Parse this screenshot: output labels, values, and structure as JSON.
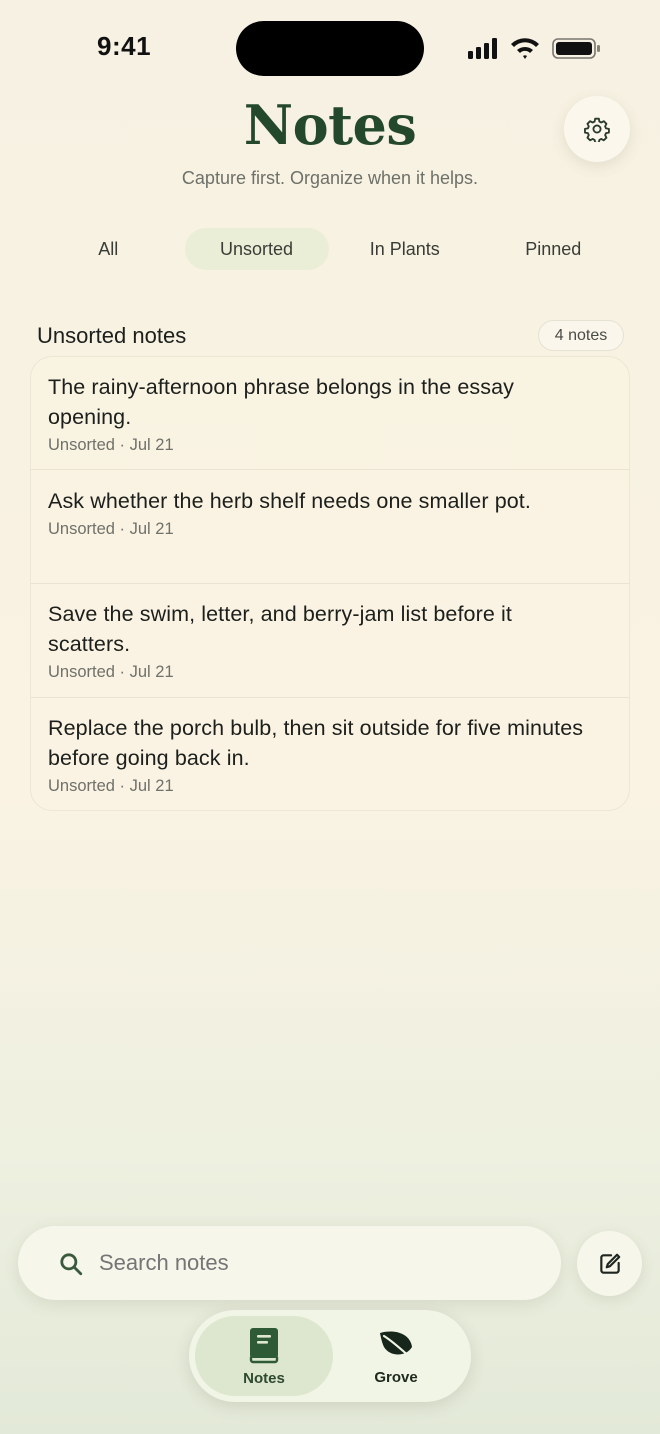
{
  "status_bar": {
    "time": "9:41"
  },
  "header": {
    "title": "Notes",
    "subtitle": "Capture first. Organize when it helps.",
    "settings_icon": "gear-icon"
  },
  "filter_tabs": [
    {
      "label": "All",
      "active": false
    },
    {
      "label": "Unsorted",
      "active": true
    },
    {
      "label": "In Plants",
      "active": false
    },
    {
      "label": "Pinned",
      "active": false
    }
  ],
  "section": {
    "title": "Unsorted notes",
    "count": "4 notes"
  },
  "notes": [
    {
      "text": "The rainy-afternoon phrase belongs in the essay opening.",
      "meta": "Unsorted · Jul 21"
    },
    {
      "text": "Ask whether the herb shelf needs one smaller pot.",
      "meta": "Unsorted · Jul 21"
    },
    {
      "text": "Save the swim, letter, and berry-jam list before it scatters.",
      "meta": "Unsorted · Jul 21"
    },
    {
      "text": "Replace the porch bulb, then sit outside for five minutes before going back in.",
      "meta": "Unsorted · Jul 21"
    }
  ],
  "search": {
    "placeholder": "Search notes",
    "value": ""
  },
  "compose_icon": "compose-icon",
  "tab_bar": [
    {
      "label": "Notes",
      "icon": "notebook-icon",
      "active": true
    },
    {
      "label": "Grove",
      "icon": "leaf-icon",
      "active": false
    }
  ],
  "colors": {
    "accent_green": "#24482b",
    "active_tab_bg": "#ebeed7",
    "background": "#f6f1e2"
  }
}
